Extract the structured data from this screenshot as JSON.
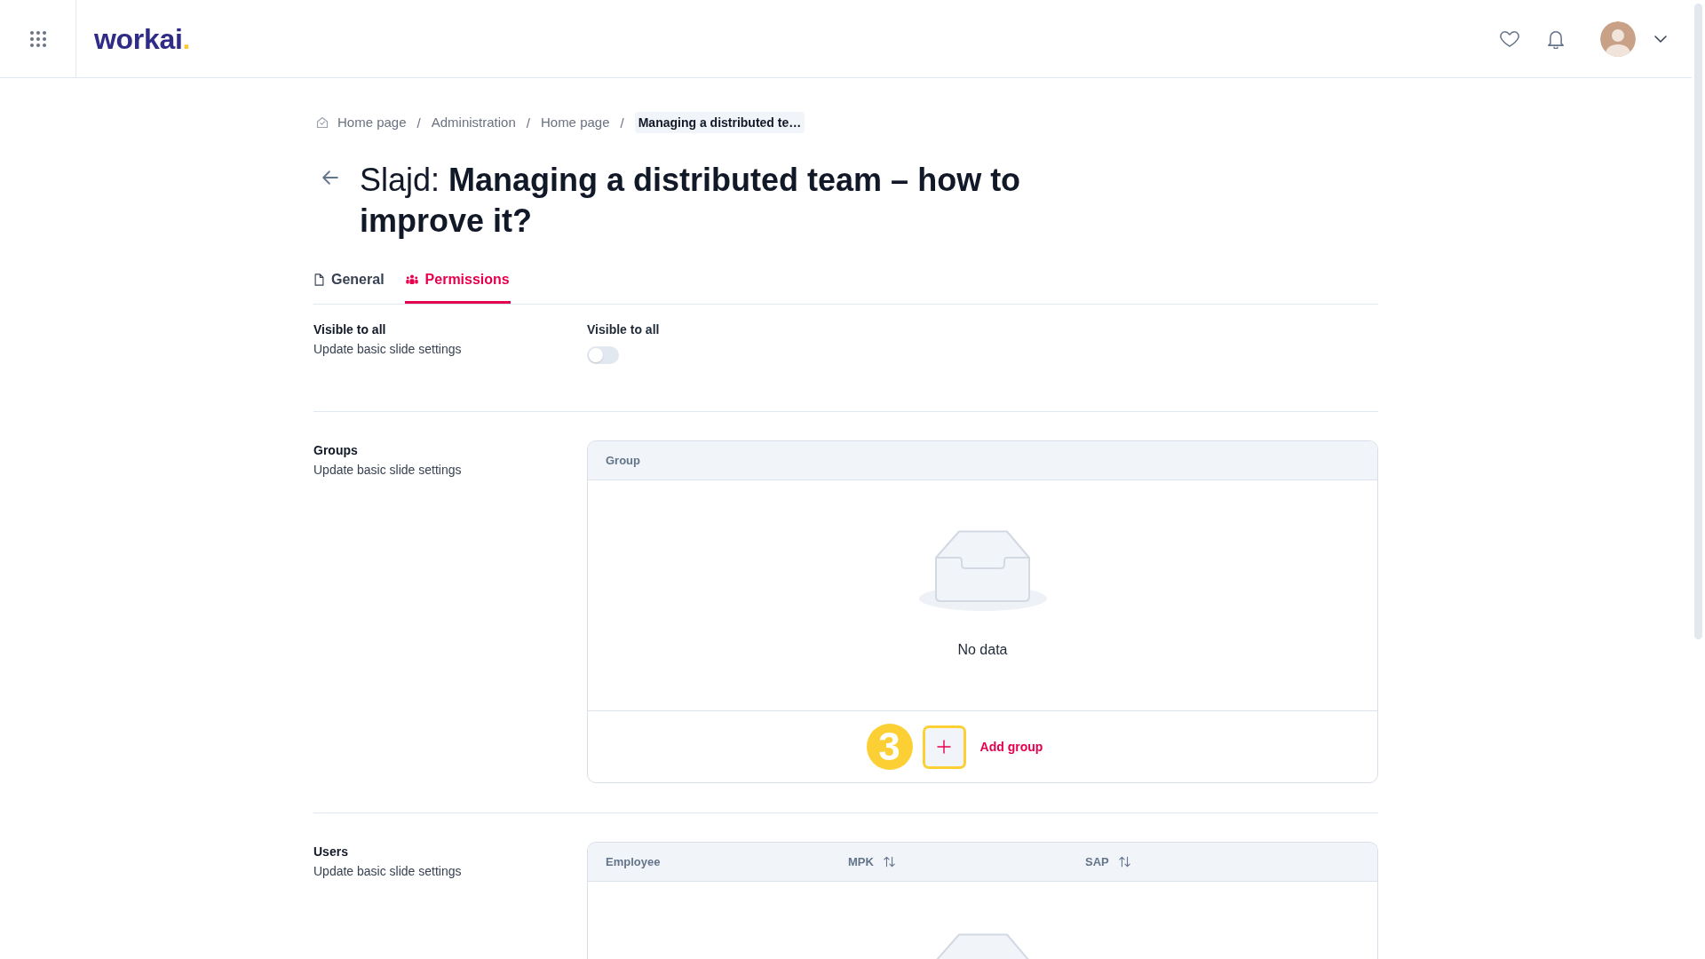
{
  "header": {
    "logo": {
      "name": "workai",
      "dot": "."
    }
  },
  "breadcrumb": {
    "items": [
      {
        "label": "Home page",
        "kind": "home",
        "current": false,
        "separator": "/"
      },
      {
        "label": "Administration",
        "kind": "link",
        "current": false,
        "separator": "/"
      },
      {
        "label": "Home page",
        "kind": "link",
        "current": false,
        "separator": "/"
      },
      {
        "label": "Managing a distributed te…",
        "kind": "link",
        "current": true
      }
    ]
  },
  "page_title": "Slajd: **Managing a distributed team – how to improve it?**",
  "tabs": [
    {
      "label": "General",
      "kind": "document",
      "selected": false
    },
    {
      "label": "Permissions",
      "kind": "people",
      "selected": true
    }
  ],
  "sections": [
    {
      "kind": "toggle",
      "title": "Visible to all",
      "description": "Update basic slide settings",
      "toggle_label": "Visible to all",
      "on": false
    },
    {
      "kind": "table",
      "title": "Groups",
      "description": "Update basic slide settings",
      "columns": [
        {
          "label": "Group",
          "sortable": false
        }
      ],
      "empty_text": "No data",
      "add_button": {
        "label": "Add group",
        "highlighted": true,
        "step_marker": "3"
      }
    },
    {
      "kind": "table",
      "title": "Users",
      "description": "Update basic slide settings",
      "columns": [
        {
          "label": "Employee",
          "sortable": false
        },
        {
          "label": "MPK",
          "sortable": true
        },
        {
          "label": "SAP",
          "sortable": true
        }
      ]
    }
  ]
}
